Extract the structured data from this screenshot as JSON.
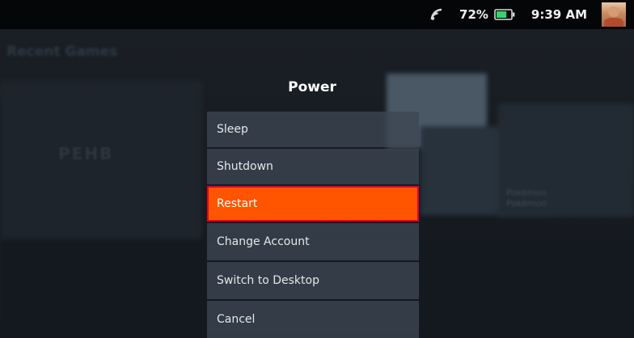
{
  "status_bar": {
    "battery_percent": "72%",
    "battery_level": 0.72,
    "time": "9:39 AM",
    "accent_color": "#3bd16f"
  },
  "background": {
    "heading": "Recent Games",
    "logo_text": "РЕНВ",
    "caption_line1": "Pokémon",
    "caption_line2": "Pokémon"
  },
  "power_menu": {
    "title": "Power",
    "items": [
      {
        "label": "Sleep"
      },
      {
        "label": "Shutdown"
      },
      {
        "label": "Restart",
        "selected": true
      },
      {
        "label": "Change Account"
      },
      {
        "label": "Switch to Desktop"
      },
      {
        "label": "Cancel"
      }
    ],
    "highlight_color": "#ff5400"
  }
}
